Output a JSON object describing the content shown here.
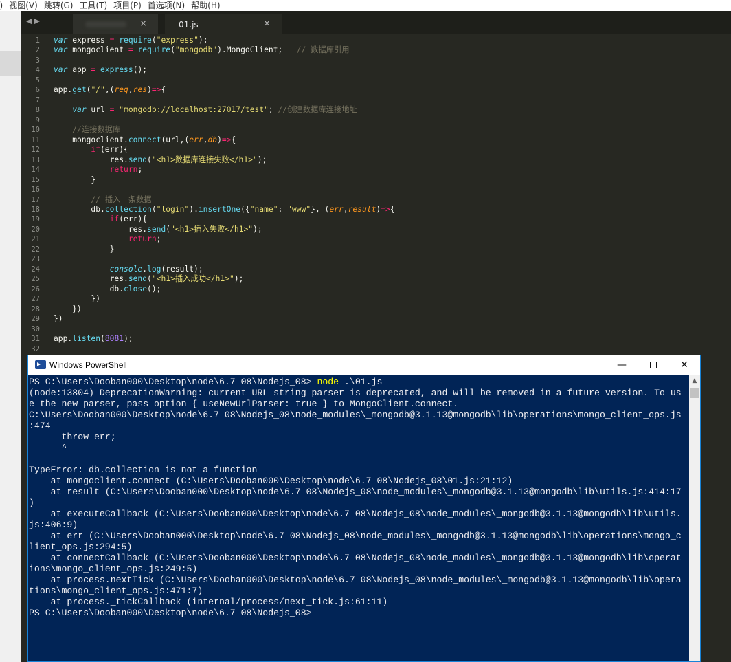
{
  "menubar": {
    "items": [
      "I)",
      "视图(V)",
      "跳转(G)",
      "工具(T)",
      "项目(P)",
      "首选项(N)",
      "帮助(H)"
    ]
  },
  "editor": {
    "tabs": [
      {
        "label": "",
        "close": "×"
      },
      {
        "label": "01.js",
        "close": "×"
      }
    ],
    "nav_arrows": "◀▶",
    "lines": [
      {
        "n": "1",
        "tokens": [
          [
            "kw",
            "var"
          ],
          [
            "pl",
            " express "
          ],
          [
            "op",
            "="
          ],
          [
            "pl",
            " "
          ],
          [
            "fn",
            "require"
          ],
          [
            "pl",
            "("
          ],
          [
            "str",
            "\"express\""
          ],
          [
            "pl",
            ");"
          ]
        ]
      },
      {
        "n": "2",
        "tokens": [
          [
            "kw",
            "var"
          ],
          [
            "pl",
            " mongoclient "
          ],
          [
            "op",
            "="
          ],
          [
            "pl",
            " "
          ],
          [
            "fn",
            "require"
          ],
          [
            "pl",
            "("
          ],
          [
            "str",
            "\"mongodb\""
          ],
          [
            "pl",
            ").MongoClient;   "
          ],
          [
            "cm",
            "// 数据库引用"
          ]
        ]
      },
      {
        "n": "3",
        "tokens": []
      },
      {
        "n": "4",
        "tokens": [
          [
            "kw",
            "var"
          ],
          [
            "pl",
            " app "
          ],
          [
            "op",
            "="
          ],
          [
            "pl",
            " "
          ],
          [
            "fn",
            "express"
          ],
          [
            "pl",
            "();"
          ]
        ]
      },
      {
        "n": "5",
        "tokens": []
      },
      {
        "n": "6",
        "tokens": [
          [
            "pl",
            "app."
          ],
          [
            "fn",
            "get"
          ],
          [
            "pl",
            "("
          ],
          [
            "str",
            "\"/\""
          ],
          [
            "pl",
            ",("
          ],
          [
            "prm",
            "req"
          ],
          [
            "pl",
            ","
          ],
          [
            "prm",
            "res"
          ],
          [
            "pl",
            ")"
          ],
          [
            "op",
            "=>"
          ],
          [
            "pl",
            "{"
          ]
        ]
      },
      {
        "n": "7",
        "tokens": []
      },
      {
        "n": "8",
        "tokens": [
          [
            "pl",
            "    "
          ],
          [
            "kw",
            "var"
          ],
          [
            "pl",
            " url "
          ],
          [
            "op",
            "="
          ],
          [
            "pl",
            " "
          ],
          [
            "str",
            "\"mongodb://localhost:27017/test\""
          ],
          [
            "pl",
            "; "
          ],
          [
            "cm",
            "//创建数据库连接地址"
          ]
        ]
      },
      {
        "n": "9",
        "tokens": []
      },
      {
        "n": "10",
        "tokens": [
          [
            "pl",
            "    "
          ],
          [
            "cm",
            "//连接数据库"
          ]
        ]
      },
      {
        "n": "11",
        "tokens": [
          [
            "pl",
            "    mongoclient."
          ],
          [
            "fn",
            "connect"
          ],
          [
            "pl",
            "(url,("
          ],
          [
            "prm",
            "err"
          ],
          [
            "pl",
            ","
          ],
          [
            "prm",
            "db"
          ],
          [
            "pl",
            ")"
          ],
          [
            "op",
            "=>"
          ],
          [
            "pl",
            "{"
          ]
        ]
      },
      {
        "n": "12",
        "tokens": [
          [
            "pl",
            "        "
          ],
          [
            "op",
            "if"
          ],
          [
            "pl",
            "(err){"
          ]
        ]
      },
      {
        "n": "13",
        "tokens": [
          [
            "pl",
            "            res."
          ],
          [
            "fn",
            "send"
          ],
          [
            "pl",
            "("
          ],
          [
            "str",
            "\"<h1>数据库连接失败</h1>\""
          ],
          [
            "pl",
            ");"
          ]
        ]
      },
      {
        "n": "14",
        "tokens": [
          [
            "pl",
            "            "
          ],
          [
            "op",
            "return"
          ],
          [
            "pl",
            ";"
          ]
        ]
      },
      {
        "n": "15",
        "tokens": [
          [
            "pl",
            "        }"
          ]
        ]
      },
      {
        "n": "16",
        "tokens": []
      },
      {
        "n": "17",
        "tokens": [
          [
            "pl",
            "        "
          ],
          [
            "cm",
            "// 插入一条数据"
          ]
        ]
      },
      {
        "n": "18",
        "tokens": [
          [
            "pl",
            "        db."
          ],
          [
            "fn",
            "collection"
          ],
          [
            "pl",
            "("
          ],
          [
            "str",
            "\"login\""
          ],
          [
            "pl",
            ")."
          ],
          [
            "fn",
            "insertOne"
          ],
          [
            "pl",
            "({"
          ],
          [
            "str",
            "\"name\""
          ],
          [
            "pl",
            ": "
          ],
          [
            "str",
            "\"www\""
          ],
          [
            "pl",
            "}, ("
          ],
          [
            "prm",
            "err"
          ],
          [
            "pl",
            ","
          ],
          [
            "prm",
            "result"
          ],
          [
            "pl",
            ")"
          ],
          [
            "op",
            "=>"
          ],
          [
            "pl",
            "{"
          ]
        ]
      },
      {
        "n": "19",
        "tokens": [
          [
            "pl",
            "            "
          ],
          [
            "op",
            "if"
          ],
          [
            "pl",
            "(err){"
          ]
        ]
      },
      {
        "n": "20",
        "tokens": [
          [
            "pl",
            "                res."
          ],
          [
            "fn",
            "send"
          ],
          [
            "pl",
            "("
          ],
          [
            "str",
            "\"<h1>插入失败</h1>\""
          ],
          [
            "pl",
            ");"
          ]
        ]
      },
      {
        "n": "21",
        "tokens": [
          [
            "pl",
            "                "
          ],
          [
            "op",
            "return"
          ],
          [
            "pl",
            ";"
          ]
        ]
      },
      {
        "n": "22",
        "tokens": [
          [
            "pl",
            "            }"
          ]
        ]
      },
      {
        "n": "23",
        "tokens": []
      },
      {
        "n": "24",
        "tokens": [
          [
            "pl",
            "            "
          ],
          [
            "it",
            "console"
          ],
          [
            "pl",
            "."
          ],
          [
            "fn",
            "log"
          ],
          [
            "pl",
            "(result);"
          ]
        ]
      },
      {
        "n": "25",
        "tokens": [
          [
            "pl",
            "            res."
          ],
          [
            "fn",
            "send"
          ],
          [
            "pl",
            "("
          ],
          [
            "str",
            "\"<h1>插入成功</h1>\""
          ],
          [
            "pl",
            ");"
          ]
        ]
      },
      {
        "n": "26",
        "tokens": [
          [
            "pl",
            "            db."
          ],
          [
            "fn",
            "close"
          ],
          [
            "pl",
            "();"
          ]
        ]
      },
      {
        "n": "27",
        "tokens": [
          [
            "pl",
            "        })"
          ]
        ]
      },
      {
        "n": "28",
        "tokens": [
          [
            "pl",
            "    })"
          ]
        ]
      },
      {
        "n": "29",
        "tokens": [
          [
            "pl",
            "})"
          ]
        ]
      },
      {
        "n": "30",
        "tokens": []
      },
      {
        "n": "31",
        "tokens": [
          [
            "pl",
            "app."
          ],
          [
            "fn",
            "listen"
          ],
          [
            "pl",
            "("
          ],
          [
            "num",
            "8081"
          ],
          [
            "pl",
            ");"
          ]
        ]
      },
      {
        "n": "32",
        "tokens": []
      }
    ]
  },
  "powershell": {
    "title": "Windows PowerShell",
    "controls": {
      "minimize": "—",
      "close": "✕"
    },
    "scroll_up": "▲",
    "lines": [
      {
        "parts": [
          [
            "",
            "PS C:\\Users\\Dooban000\\Desktop\\node\\6.7-08\\Nodejs_08> "
          ],
          [
            "cmd",
            "node"
          ],
          [
            "",
            " .\\01.js"
          ]
        ]
      },
      {
        "parts": [
          [
            "",
            "(node:13804) DeprecationWarning: current URL string parser is deprecated, and will be removed in a future version. To us"
          ]
        ]
      },
      {
        "parts": [
          [
            "",
            "e the new parser, pass option { useNewUrlParser: true } to MongoClient.connect."
          ]
        ]
      },
      {
        "parts": [
          [
            "",
            "C:\\Users\\Dooban000\\Desktop\\node\\6.7-08\\Nodejs_08\\node_modules\\_mongodb@3.1.13@mongodb\\lib\\operations\\mongo_client_ops.js"
          ]
        ]
      },
      {
        "parts": [
          [
            "",
            ":474"
          ]
        ]
      },
      {
        "parts": [
          [
            "",
            "      throw err;"
          ]
        ]
      },
      {
        "parts": [
          [
            "",
            "      ^"
          ]
        ]
      },
      {
        "parts": [
          [
            "",
            ""
          ]
        ]
      },
      {
        "parts": [
          [
            "",
            "TypeError: db.collection is not a function"
          ]
        ]
      },
      {
        "parts": [
          [
            "",
            "    at mongoclient.connect (C:\\Users\\Dooban000\\Desktop\\node\\6.7-08\\Nodejs_08\\01.js:21:12)"
          ]
        ]
      },
      {
        "parts": [
          [
            "",
            "    at result (C:\\Users\\Dooban000\\Desktop\\node\\6.7-08\\Nodejs_08\\node_modules\\_mongodb@3.1.13@mongodb\\lib\\utils.js:414:17"
          ]
        ]
      },
      {
        "parts": [
          [
            "",
            ")"
          ]
        ]
      },
      {
        "parts": [
          [
            "",
            "    at executeCallback (C:\\Users\\Dooban000\\Desktop\\node\\6.7-08\\Nodejs_08\\node_modules\\_mongodb@3.1.13@mongodb\\lib\\utils."
          ]
        ]
      },
      {
        "parts": [
          [
            "",
            "js:406:9)"
          ]
        ]
      },
      {
        "parts": [
          [
            "",
            "    at err (C:\\Users\\Dooban000\\Desktop\\node\\6.7-08\\Nodejs_08\\node_modules\\_mongodb@3.1.13@mongodb\\lib\\operations\\mongo_c"
          ]
        ]
      },
      {
        "parts": [
          [
            "",
            "lient_ops.js:294:5)"
          ]
        ]
      },
      {
        "parts": [
          [
            "",
            "    at connectCallback (C:\\Users\\Dooban000\\Desktop\\node\\6.7-08\\Nodejs_08\\node_modules\\_mongodb@3.1.13@mongodb\\lib\\operat"
          ]
        ]
      },
      {
        "parts": [
          [
            "",
            "ions\\mongo_client_ops.js:249:5)"
          ]
        ]
      },
      {
        "parts": [
          [
            "",
            "    at process.nextTick (C:\\Users\\Dooban000\\Desktop\\node\\6.7-08\\Nodejs_08\\node_modules\\_mongodb@3.1.13@mongodb\\lib\\opera"
          ]
        ]
      },
      {
        "parts": [
          [
            "",
            "tions\\mongo_client_ops.js:471:7)"
          ]
        ]
      },
      {
        "parts": [
          [
            "",
            "    at process._tickCallback (internal/process/next_tick.js:61:11)"
          ]
        ]
      },
      {
        "parts": [
          [
            "",
            "PS C:\\Users\\Dooban000\\Desktop\\node\\6.7-08\\Nodejs_08>"
          ]
        ]
      }
    ]
  }
}
